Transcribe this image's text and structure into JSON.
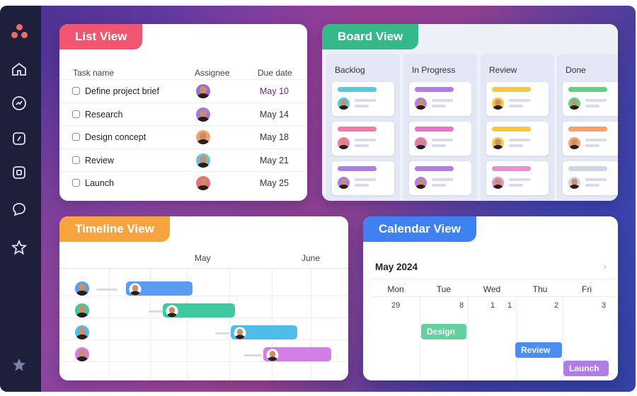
{
  "colors": {
    "list_tag": "#f0566f",
    "board_tag": "#35b88a",
    "timeline_tag": "#f7a440",
    "calendar_tag": "#3d82f0",
    "due_accent": "#6b2c73"
  },
  "sidebar": {
    "icons": [
      "logo-icon",
      "home-icon",
      "goals-icon",
      "portfolio-icon",
      "inbox-icon",
      "messages-icon",
      "star-icon",
      "favorites-star-icon"
    ]
  },
  "list_view": {
    "title": "List View",
    "columns": {
      "task": "Task name",
      "assignee": "Assignee",
      "due": "Due date"
    },
    "rows": [
      {
        "task": "Define project brief",
        "due": "May 10",
        "avatar_color": "#a06ad0"
      },
      {
        "task": "Research",
        "due": "May 14",
        "avatar_color": "#9b7be0"
      },
      {
        "task": "Design concept",
        "due": "May 18",
        "avatar_color": "#f0a36a"
      },
      {
        "task": "Review",
        "due": "May 21",
        "avatar_color": "#6ac4d8"
      },
      {
        "task": "Launch",
        "due": "May 25",
        "avatar_color": "#f06a7a"
      }
    ]
  },
  "board_view": {
    "title": "Board View",
    "columns": [
      {
        "title": "Backlog",
        "card_colors": [
          "#5ac8dc",
          "#f07aa8",
          "#a77fe6"
        ]
      },
      {
        "title": "In Progress",
        "card_colors": [
          "#b57be8",
          "#e774c8",
          "#b57be8"
        ]
      },
      {
        "title": "Review",
        "card_colors": [
          "#f5c842",
          "#f5c842",
          "#e690d0"
        ]
      },
      {
        "title": "Done",
        "card_colors": [
          "#5fd08a",
          "#f5a06a",
          "#cfd4e4"
        ]
      }
    ]
  },
  "timeline_view": {
    "title": "Timeline View",
    "months": [
      "May",
      "June"
    ],
    "rows": [
      {
        "color": "#5b9cf0"
      },
      {
        "color": "#3ec9a0"
      },
      {
        "color": "#4fbde8"
      },
      {
        "color": "#d37ee6"
      }
    ]
  },
  "calendar_view": {
    "title": "Calendar View",
    "month": "May 2024",
    "days": [
      "Mon",
      "Tue",
      "Wed",
      "Thu",
      "Fri"
    ],
    "dates": [
      "29",
      "8",
      "1",
      "1",
      "2",
      "3"
    ],
    "events": [
      {
        "label": "Design",
        "color": "#66cf9e"
      },
      {
        "label": "Review",
        "color": "#4a8ef0"
      },
      {
        "label": "Launch",
        "color": "#b07de8"
      }
    ]
  }
}
